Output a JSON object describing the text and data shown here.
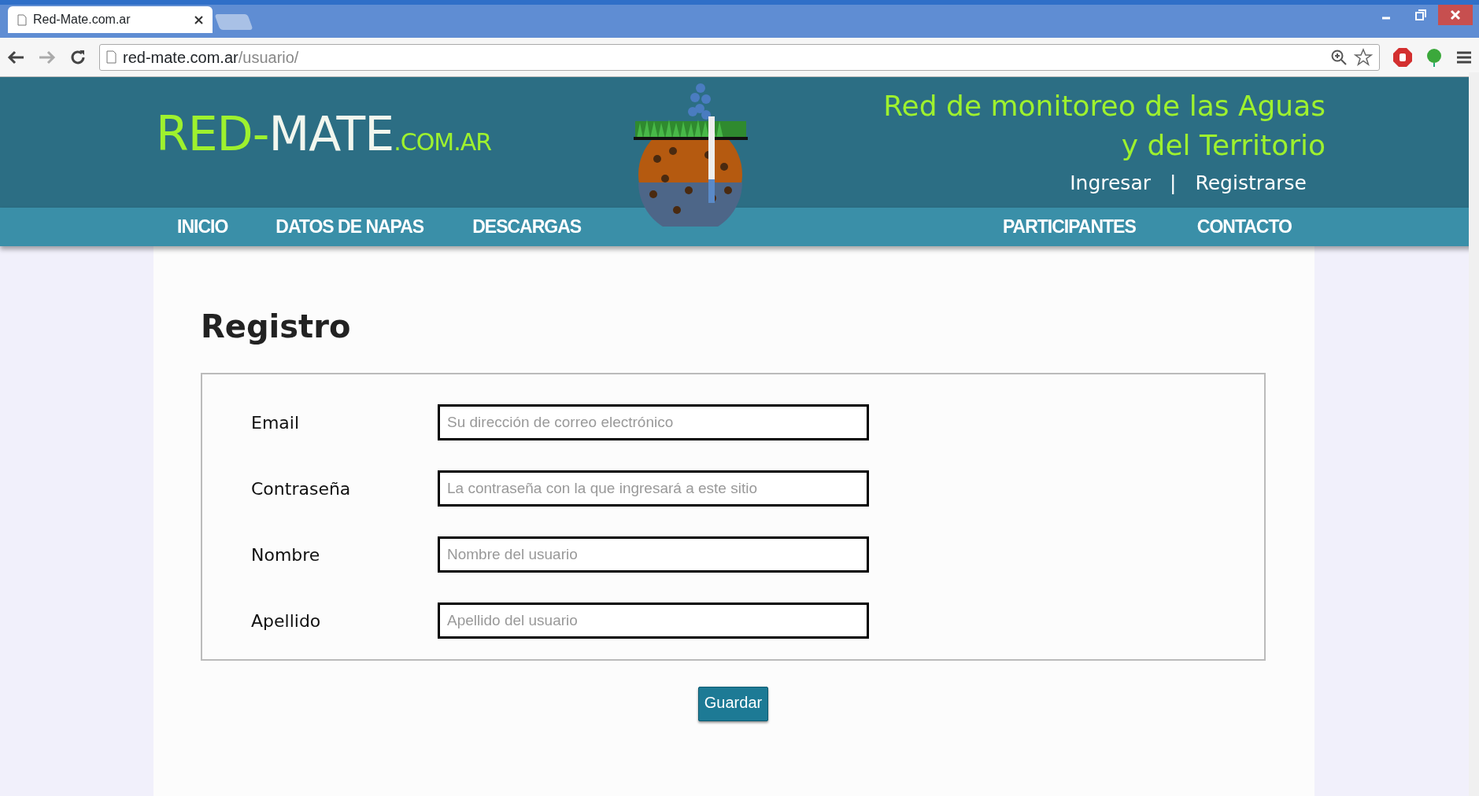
{
  "browser": {
    "tabs": [
      {
        "title": "Red-Mate.com.ar",
        "selected": true
      }
    ],
    "url": {
      "host": "red-mate.com.ar",
      "path": "/usuario/"
    }
  },
  "header": {
    "logo": {
      "first": "RED-",
      "second": "MATE",
      "suffix": ".COM.AR"
    },
    "tagline": [
      "Red de monitoreo de las Aguas",
      "y del Territorio"
    ],
    "auth_links": [
      "Ingresar",
      "Registrarse"
    ],
    "separator": "|"
  },
  "nav": {
    "left": [
      "INICIO",
      "DATOS DE NAPAS",
      "DESCARGAS"
    ],
    "right": [
      "PARTICIPANTES",
      "CONTACTO"
    ]
  },
  "form": {
    "title": "Registro",
    "fields": [
      {
        "label": "Email",
        "placeholder": "Su dirección de correo electrónico"
      },
      {
        "label": "Contraseña",
        "placeholder": "La contraseña con la que ingresará a este sitio"
      },
      {
        "label": "Nombre",
        "placeholder": "Nombre del usuario"
      },
      {
        "label": "Apellido",
        "placeholder": "Apellido del usuario"
      }
    ],
    "button": "Guardar"
  }
}
